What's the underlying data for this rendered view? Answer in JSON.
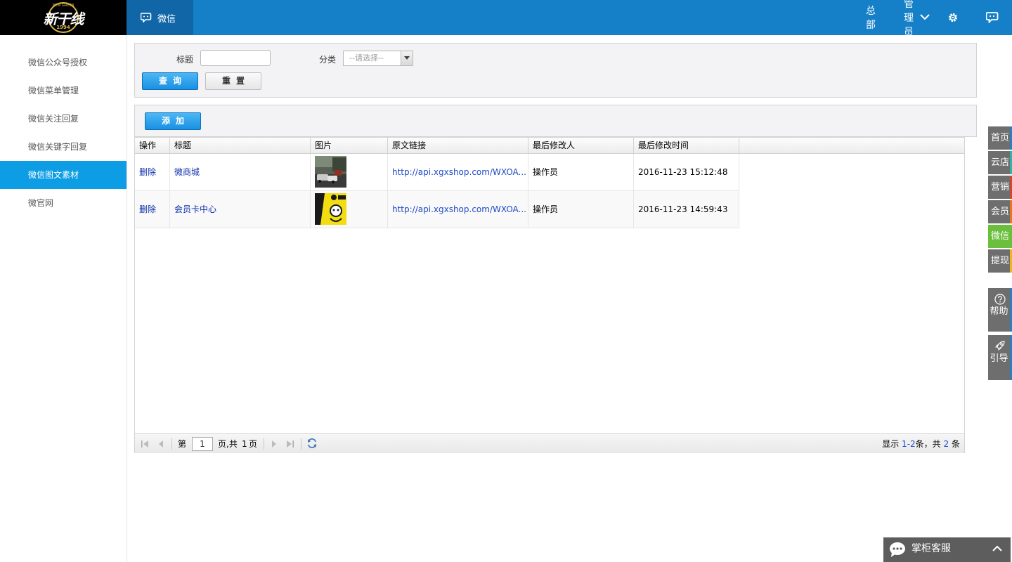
{
  "header": {
    "logo_text": "新干线",
    "logo_arc_text": "NEW GREEN",
    "logo_year": "1994",
    "module_tab": "微信",
    "org": "总部",
    "user": "管理员"
  },
  "sidebar": {
    "items": [
      {
        "label": "微信公众号授权",
        "active": false
      },
      {
        "label": "微信菜单管理",
        "active": false
      },
      {
        "label": "微信关注回复",
        "active": false
      },
      {
        "label": "微信关键字回复",
        "active": false
      },
      {
        "label": "微信图文素材",
        "active": true
      },
      {
        "label": "微官网",
        "active": false
      }
    ]
  },
  "search": {
    "title_label": "标题",
    "title_value": "",
    "category_label": "分类",
    "category_selected": "--请选择--",
    "query_button": "查询",
    "reset_button": "重置"
  },
  "toolbar": {
    "add_button": "添加"
  },
  "grid": {
    "columns": [
      "操作",
      "标题",
      "图片",
      "原文链接",
      "最后修改人",
      "最后修改时间"
    ],
    "rows": [
      {
        "action": "删除",
        "title": "微商城",
        "image": "street-photo",
        "url": "http://api.xgxshop.com/WXOA...",
        "modifier": "操作员",
        "modified": "2016-11-23 15:12:48"
      },
      {
        "action": "删除",
        "title": "会员卡中心",
        "image": "vip-card-photo",
        "url": "http://api.xgxshop.com/WXOA...",
        "modifier": "操作员",
        "modified": "2016-11-23 14:59:43"
      }
    ]
  },
  "pager": {
    "page_prefix": "第",
    "page_value": "1",
    "page_suffix": "页,共",
    "total_pages": "1",
    "page_unit": "页",
    "info_prefix": "显示",
    "range_from": "1",
    "range_dash": "-",
    "range_to": "2",
    "info_mid": "条，共",
    "total": "2",
    "info_suffix": "条"
  },
  "dock": {
    "items": [
      {
        "label": "首页",
        "color": "#2a7fc2"
      },
      {
        "label": "云店",
        "color": "#31b2a8"
      },
      {
        "label": "营销",
        "color": "#d64532"
      },
      {
        "label": "会员",
        "color": "#e8761f"
      },
      {
        "label": "微信",
        "color": "#6abf3d"
      },
      {
        "label": "提现",
        "color": "#f1b51c"
      }
    ],
    "help": "帮助",
    "guide": "引导"
  },
  "chat_widget": {
    "label": "掌柜客服"
  },
  "colors": {
    "header_bg": "#1580c7",
    "active_tab_bg": "#1166a8",
    "sidebar_active": "#0c9de4",
    "wechat_dock": "#6abf3d"
  }
}
